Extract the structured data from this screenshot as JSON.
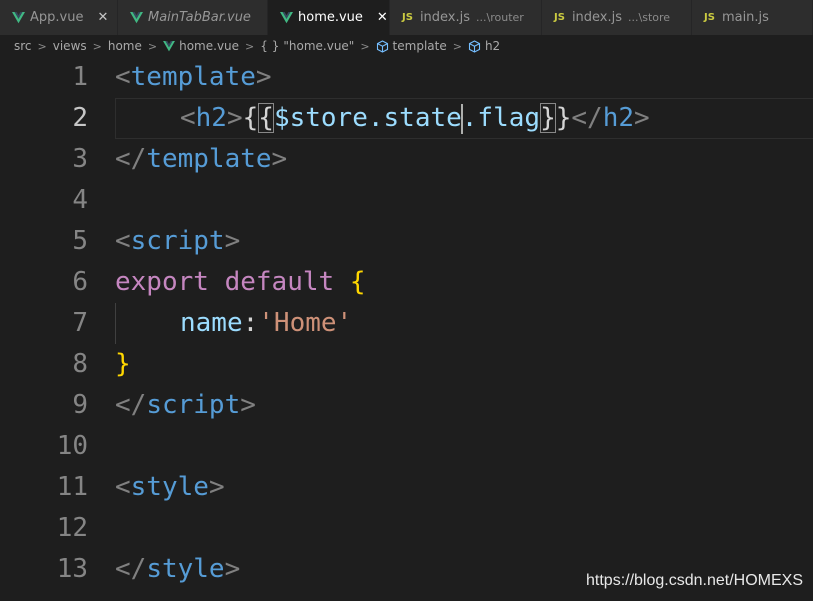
{
  "tabs": [
    {
      "icon": "vue-icon",
      "name": "App.vue",
      "close": "✕"
    },
    {
      "icon": "vue-icon",
      "name": "MainTabBar.vue"
    },
    {
      "icon": "vue-icon",
      "name": "home.vue",
      "close": "✕"
    },
    {
      "icon": "js-icon",
      "icon_text": "JS",
      "name": "index.js",
      "path": "...\\router"
    },
    {
      "icon": "js-icon",
      "icon_text": "JS",
      "name": "index.js",
      "path": "...\\store"
    },
    {
      "icon": "js-icon",
      "icon_text": "JS",
      "name": "main.js"
    }
  ],
  "breadcrumb": {
    "items": [
      "src",
      "views",
      "home",
      "home.vue",
      "{ }",
      "\"home.vue\"",
      "template",
      "h2"
    ],
    "separator": ">"
  },
  "editor": {
    "line_numbers": [
      "1",
      "2",
      "3",
      "4",
      "5",
      "6",
      "7",
      "8",
      "9",
      "10",
      "11",
      "12",
      "13"
    ],
    "line1": {
      "lt": "<",
      "tag": "template",
      "gt": ">"
    },
    "line2": {
      "lt": "<",
      "tag": "h2",
      "gt": ">",
      "open_a": "{",
      "open_b": "{",
      "expr_a": "$store.state",
      "expr_b": ".flag",
      "close_a": "}",
      "close_b": "}",
      "end_lt": "</",
      "end_tag": "h2",
      "end_gt": ">"
    },
    "line3": {
      "lt": "</",
      "tag": "template",
      "gt": ">"
    },
    "line5": {
      "lt": "<",
      "tag": "script",
      "gt": ">"
    },
    "line6": {
      "kw1": "export",
      "kw2": "default",
      "brace": "{"
    },
    "line7": {
      "key": "name",
      "colon": ":",
      "value": "'Home'"
    },
    "line8": {
      "brace": "}"
    },
    "line9": {
      "lt": "</",
      "tag": "script",
      "gt": ">"
    },
    "line11": {
      "lt": "<",
      "tag": "style",
      "gt": ">"
    },
    "line13": {
      "lt": "</",
      "tag": "style",
      "gt": ">"
    }
  },
  "colors": {
    "vue_green": "#41b883",
    "js_yellow": "#cbcb41",
    "tag_blue": "#569cd6",
    "keyword_purple": "#c586c0",
    "string_orange": "#ce9178",
    "variable_light_blue": "#9cdcfe"
  },
  "watermark": "https://blog.csdn.net/HOMEXS"
}
